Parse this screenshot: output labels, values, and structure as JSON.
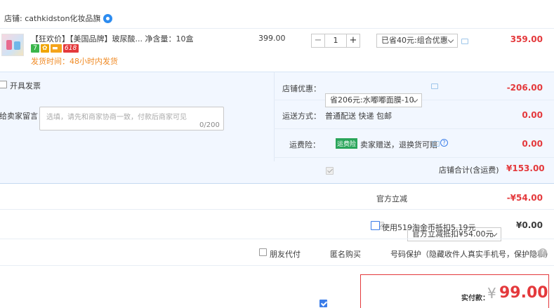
{
  "shop": {
    "label": "店铺: cathkidston化妆品旗"
  },
  "item": {
    "title": "【狂欢价】【美国品牌】玻尿酸...  净含量：10盒",
    "badges": [
      "7",
      "",
      "",
      "618"
    ],
    "ship_time": "发货时间：48小时内发货",
    "price": "399.00",
    "qty": "1",
    "promo_select": "已省40元:组合优惠",
    "subtotal": "359.00"
  },
  "invoice": {
    "label": "开具发票"
  },
  "message": {
    "label": "给卖家留言：",
    "placeholder": "选填，请先和商家协商一致，付款后商家可见",
    "count": "0/200"
  },
  "shop_discount": {
    "label": "店铺优惠：",
    "select": "省206元:水嘟嘟面膜-10",
    "amount": "-206.00"
  },
  "shipping": {
    "label": "运送方式：",
    "value": "普通配送 快递 包邮",
    "amount": "0.00"
  },
  "insurance": {
    "label": "运费险：",
    "tag": "运费险",
    "value": "卖家赠送，退换货可赔",
    "amount": "0.00"
  },
  "shop_total": {
    "label": "店铺合计(含运费)",
    "amount": "¥153.00"
  },
  "official_discount": {
    "label": "官方立减",
    "select": "官方立减抵扣¥54.00元",
    "amount": "-¥54.00"
  },
  "taojinbi": {
    "label": "使用519淘金币抵扣5.19元",
    "amount": "¥0.00"
  },
  "options": {
    "friend_pay": "朋友代付",
    "anonymous": "匿名购买",
    "number_protect": "号码保护（隐藏收件人真实手机号，保护隐私）"
  },
  "payment": {
    "label": "实付款：",
    "currency": "¥",
    "amount": "99.00"
  },
  "colors": {
    "accent_red": "#e4393c",
    "accent_blue": "#3b7de9",
    "panel_bg": "#f2f7ff"
  }
}
